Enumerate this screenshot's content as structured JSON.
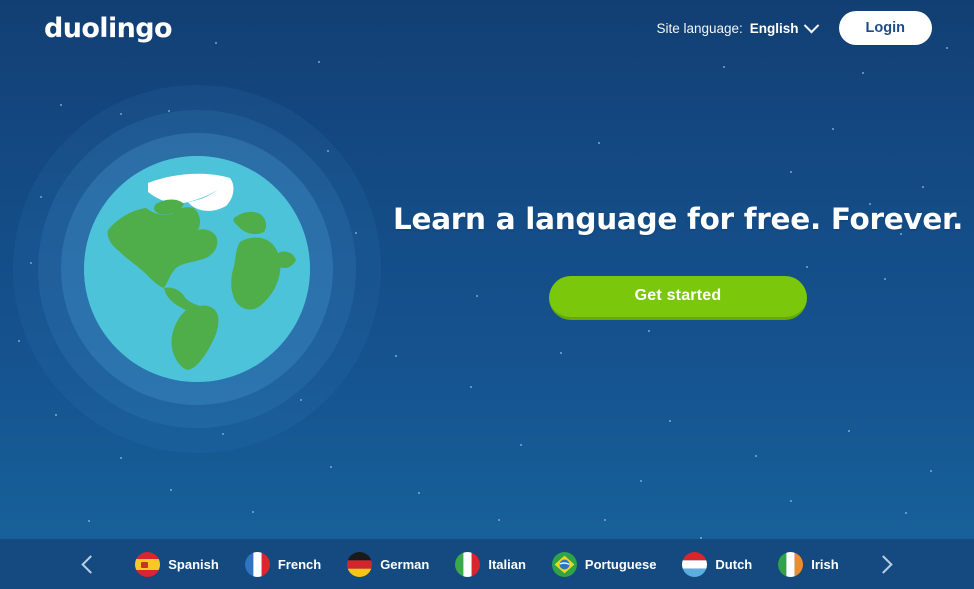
{
  "brand": {
    "logo_text": "duolingo"
  },
  "header": {
    "site_language_label": "Site language:",
    "site_language_value": "English",
    "chevron_icon": "chevron-down-icon",
    "login_label": "Login"
  },
  "hero": {
    "headline": "Learn a language for free. Forever.",
    "cta_label": "Get started"
  },
  "globe": {
    "icon": "earth-globe-illustration"
  },
  "language_bar": {
    "prev_icon": "chevron-left-icon",
    "next_icon": "chevron-right-icon",
    "languages": [
      {
        "label": "Spanish",
        "flag": "flag-spain"
      },
      {
        "label": "French",
        "flag": "flag-france"
      },
      {
        "label": "German",
        "flag": "flag-germany"
      },
      {
        "label": "Italian",
        "flag": "flag-italy"
      },
      {
        "label": "Portuguese",
        "flag": "flag-brazil"
      },
      {
        "label": "Dutch",
        "flag": "flag-netherlands"
      },
      {
        "label": "Irish",
        "flag": "flag-ireland"
      }
    ]
  },
  "colors": {
    "sky_dark": "#123f73",
    "sky_light": "#176199",
    "bar_background": "#144a7f",
    "cta_green": "#7ac70c",
    "login_text": "#1b4d87",
    "text_white": "#ffffff",
    "globe_ocean": "#4cc3d9",
    "globe_land": "#4fae4a"
  }
}
